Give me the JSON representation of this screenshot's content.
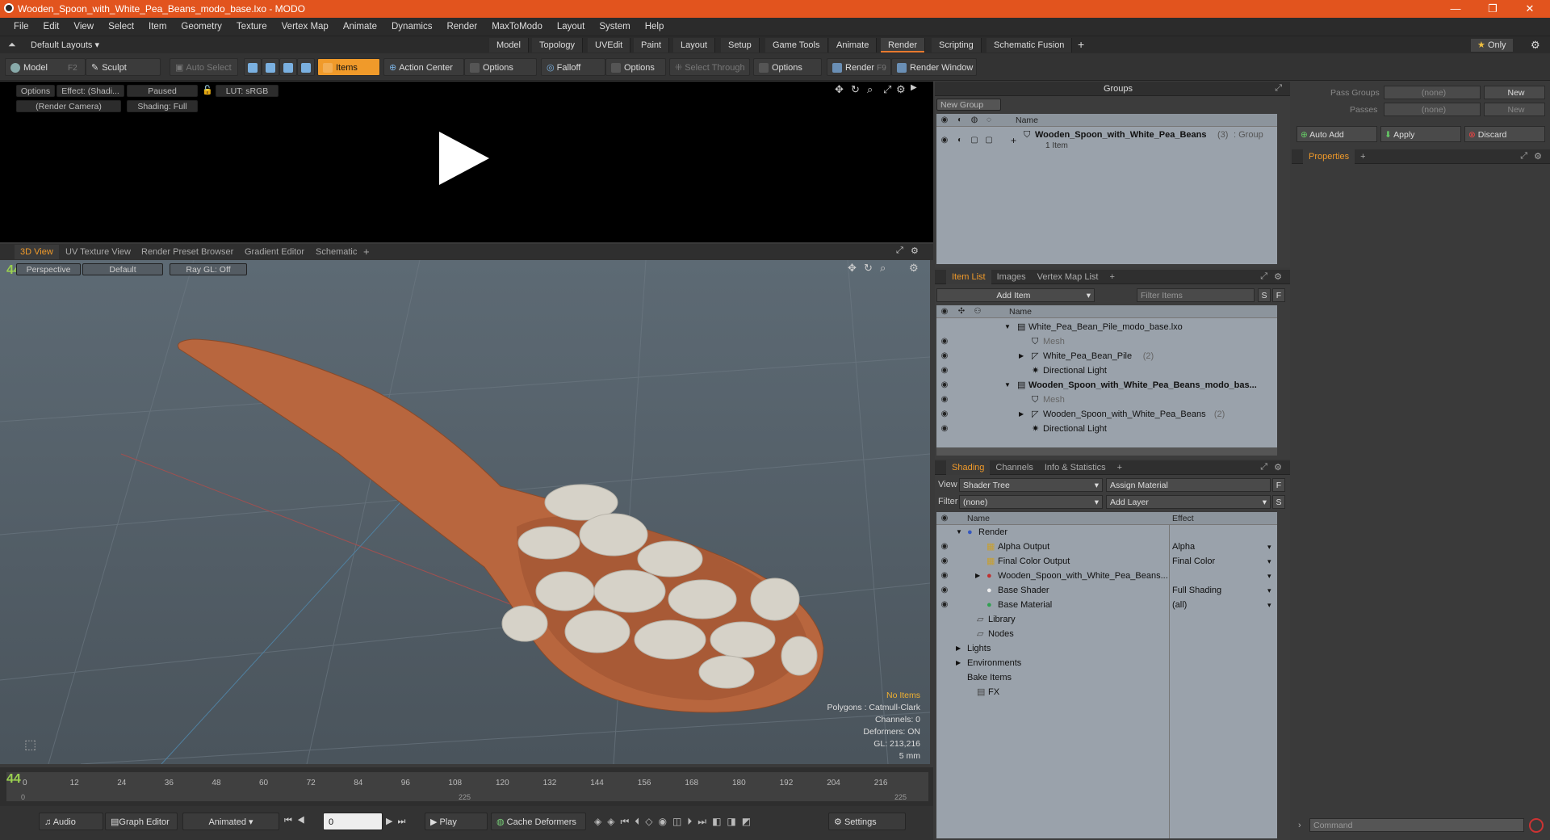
{
  "window": {
    "title": "Wooden_Spoon_with_White_Pea_Beans_modo_base.lxo - MODO",
    "minimize": "—",
    "restore": "❐",
    "close": "✕"
  },
  "menu": [
    "File",
    "Edit",
    "View",
    "Select",
    "Item",
    "Geometry",
    "Texture",
    "Vertex Map",
    "Animate",
    "Dynamics",
    "Render",
    "MaxToModo",
    "Layout",
    "System",
    "Help"
  ],
  "layouts": {
    "current": "Default Layouts",
    "tabs": [
      "Model",
      "Topology",
      "UVEdit",
      "Paint",
      "Layout",
      "Setup",
      "Game Tools",
      "Animate",
      "Render",
      "Scripting",
      "Schematic Fusion"
    ],
    "active": "Render",
    "add": "+",
    "only": "Only"
  },
  "toolbar": {
    "model": "Model",
    "model_key": "F2",
    "sculpt": "Sculpt",
    "auto_select": "Auto Select",
    "items": "Items",
    "action_center": "Action Center",
    "options1": "Options",
    "falloff": "Falloff",
    "options2": "Options",
    "select_through": "Select Through",
    "options3": "Options",
    "render": "Render",
    "render_key": "F9",
    "render_window": "Render Window"
  },
  "render_preview": {
    "options": "Options",
    "effect": "Effect: (Shadi...",
    "paused": "Paused",
    "lut": "LUT: sRGB",
    "camera": "(Render Camera)",
    "shading": "Shading: Full"
  },
  "viewport_tabs": [
    "3D View",
    "UV Texture View",
    "Render Preset Browser",
    "Gradient Editor",
    "Schematic"
  ],
  "viewport": {
    "perspective": "Perspective",
    "default": "Default",
    "raygl": "Ray GL: Off",
    "fps": "44",
    "stats": {
      "no_items": "No Items",
      "polygons": "Polygons : Catmull-Clark",
      "channels": "Channels: 0",
      "deformers": "Deformers: ON",
      "gl": "GL: 213,216",
      "unit": "5 mm"
    }
  },
  "timeline": {
    "ticks": [
      "0",
      "12",
      "24",
      "36",
      "48",
      "60",
      "72",
      "84",
      "96",
      "108",
      "120",
      "132",
      "144",
      "156",
      "168",
      "180",
      "192",
      "204",
      "216"
    ],
    "start": "0",
    "end": "225",
    "mid": "225",
    "fps": "44"
  },
  "bottombar": {
    "audio": "Audio",
    "graph_editor": "Graph Editor",
    "animated": "Animated",
    "frame": "0",
    "play": "Play",
    "cache_deformers": "Cache Deformers",
    "settings": "Settings"
  },
  "groups": {
    "title": "Groups",
    "new_group": "New Group",
    "col_name": "Name",
    "item_name": "Wooden_Spoon_with_White_Pea_Beans",
    "item_count": "(3)",
    "item_type": ": Group",
    "item_sub": "1 Item"
  },
  "item_list": {
    "tabs": [
      "Item List",
      "Images",
      "Vertex Map List"
    ],
    "add_item": "Add Item",
    "filter": "Filter Items",
    "s": "S",
    "f": "F",
    "col_name": "Name",
    "rows": [
      {
        "label": "White_Pea_Bean_Pile_modo_base.lxo",
        "bold": false
      },
      {
        "label": "Mesh",
        "bold": false
      },
      {
        "label": "White_Pea_Bean_Pile",
        "count": "(2)",
        "bold": false
      },
      {
        "label": "Directional Light",
        "bold": false
      },
      {
        "label": "Wooden_Spoon_with_White_Pea_Beans_modo_bas...",
        "bold": true
      },
      {
        "label": "Mesh",
        "bold": false
      },
      {
        "label": "Wooden_Spoon_with_White_Pea_Beans",
        "count": "(2)",
        "bold": false
      },
      {
        "label": "Directional Light",
        "bold": false
      }
    ]
  },
  "shading": {
    "tabs": [
      "Shading",
      "Channels",
      "Info & Statistics"
    ],
    "view_label": "View",
    "view_value": "Shader Tree",
    "assign": "Assign Material",
    "filter_label": "Filter",
    "filter_value": "(none)",
    "add_layer": "Add Layer",
    "f": "F",
    "s": "S",
    "col_name": "Name",
    "col_effect": "Effect",
    "rows": [
      {
        "name": "Render",
        "effect": ""
      },
      {
        "name": "Alpha Output",
        "effect": "Alpha"
      },
      {
        "name": "Final Color Output",
        "effect": "Final Color"
      },
      {
        "name": "Wooden_Spoon_with_White_Pea_Beans...",
        "effect": ""
      },
      {
        "name": "Base Shader",
        "effect": "Full Shading"
      },
      {
        "name": "Base Material",
        "effect": "(all)"
      },
      {
        "name": "Library",
        "effect": ""
      },
      {
        "name": "Nodes",
        "effect": ""
      },
      {
        "name": "Lights",
        "effect": ""
      },
      {
        "name": "Environments",
        "effect": ""
      },
      {
        "name": "Bake Items",
        "effect": ""
      },
      {
        "name": "FX",
        "effect": ""
      }
    ]
  },
  "pass": {
    "pass_groups": "Pass Groups",
    "passes": "Passes",
    "none1": "(none)",
    "none2": "(none)",
    "new1": "New",
    "new2": "New",
    "auto_add": "Auto Add",
    "apply": "Apply",
    "discard": "Discard",
    "properties": "Properties",
    "add": "+"
  },
  "command": {
    "placeholder": "Command"
  },
  "colors": {
    "accent": "#f09a2a",
    "title": "#e2541e"
  }
}
